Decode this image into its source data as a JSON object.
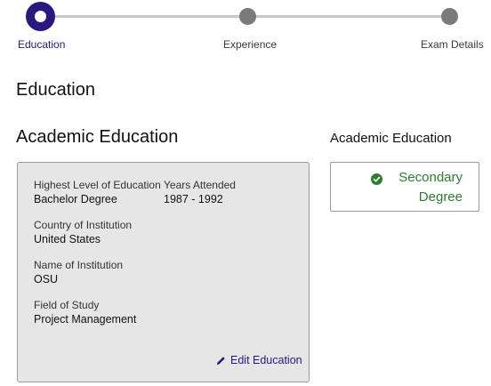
{
  "stepper": {
    "steps": [
      {
        "label": "Education"
      },
      {
        "label": "Experience"
      },
      {
        "label": "Exam Details"
      }
    ]
  },
  "page": {
    "title": "Education"
  },
  "academic": {
    "section_title": "Academic Education",
    "highest_level_label": "Highest Level of Education",
    "highest_level_value": "Bachelor Degree",
    "years_label": "Years Attended",
    "years_value": "1987 - 1992",
    "country_label": "Country of Institution",
    "country_value": "United States",
    "institution_label": "Name of Institution",
    "institution_value": "OSU",
    "field_label": "Field of Study",
    "field_value": "Project Management",
    "edit_label": "Edit Education"
  },
  "side": {
    "title": "Academic Education",
    "status_text": "Secondary Degree",
    "status_icon": "check-circle-icon",
    "status_color": "#2e7d32"
  },
  "colors": {
    "accent": "#2b1780",
    "inactive_step": "#7a7a7a",
    "card_bg": "#e6e6e6"
  }
}
